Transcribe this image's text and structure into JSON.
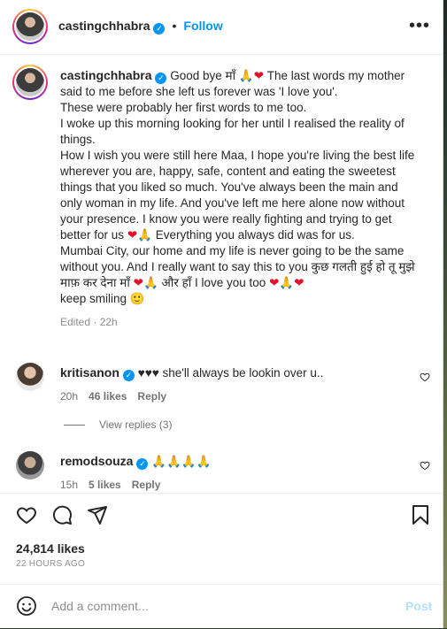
{
  "post": {
    "author": "castingchhabra",
    "follow_label": "Follow",
    "dot": "•",
    "caption_lines": [
      "These were probably her first words to me too.",
      "I woke up this morning looking for her until I realised the reality of things.",
      "How I wish you were still here Maa, I hope you're living the best life wherever you are, happy, safe, content and eating the sweetest things that you liked so much. You've always been the main and only woman in my life. And you've left me here alone now without your presence. I know you were really fighting and trying to get better for us",
      "Everything you always did was for us.",
      "Mumbai City, our home and my life is never going to be the same without you. And I really want to say this to you कुछ गलती हुई हो तू मुझे माफ़ कर देना माँ",
      "और हाँ I love you too",
      "keep smiling"
    ],
    "caption_first_a": "Good bye माँ",
    "caption_first_b": "The last words my mother said to me before she left us forever was 'I love you'.",
    "edited": "Edited · 22h"
  },
  "comments": [
    {
      "user": "kritisanon",
      "text": "♥♥♥ she'll always be lookin over u..",
      "time": "20h",
      "likes": "46 likes",
      "reply": "Reply"
    },
    {
      "user": "remodsouza",
      "text": "🙏🙏🙏🙏",
      "time": "15h",
      "likes": "5 likes",
      "reply": "Reply"
    }
  ],
  "view_replies": "View replies (3)",
  "footer": {
    "likes": "24,814 likes",
    "time": "22 HOURS AGO",
    "add_comment_placeholder": "Add a comment...",
    "post_label": "Post"
  },
  "icons": {
    "heart": "heart-icon",
    "comment": "comment-icon",
    "share": "share-icon",
    "save": "bookmark-icon",
    "more": "more-options-icon",
    "emoji": "emoji-icon"
  },
  "colors": {
    "link_blue": "#0095f6",
    "post_disabled": "#b2dffc",
    "verified": "#0095f6",
    "heart_emoji": "#e0132b"
  }
}
